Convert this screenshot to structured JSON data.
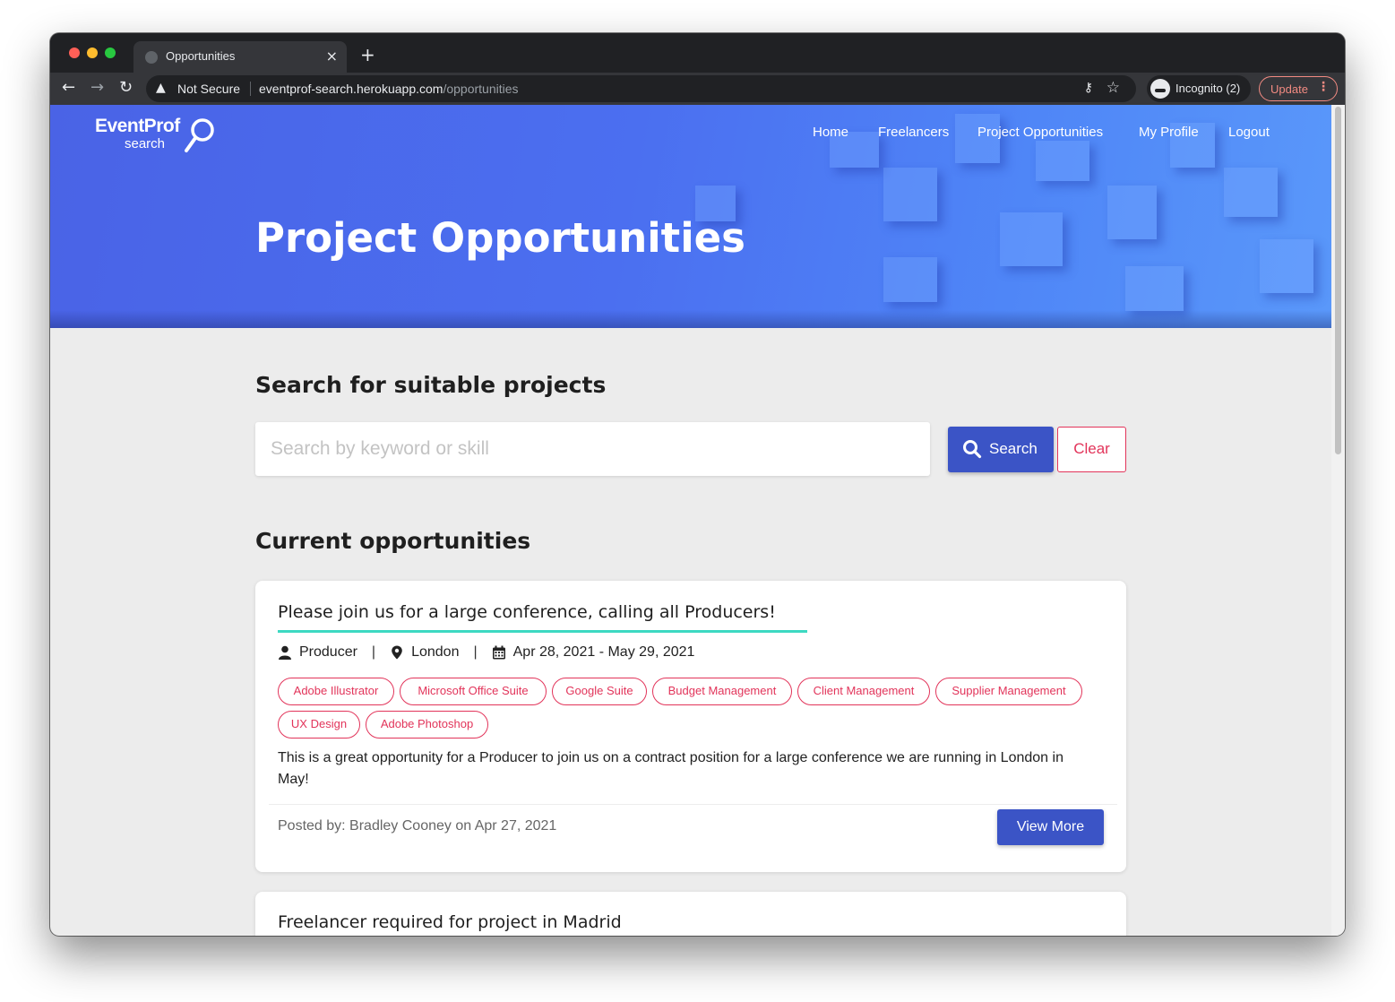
{
  "browser": {
    "tab_title": "Opportunities",
    "tab_close": "×",
    "new_tab": "+",
    "not_secure": "Not Secure",
    "url_host": "eventprof-search.herokuapp.com",
    "url_path": "/opportunities",
    "incognito_label": "Incognito (2)",
    "update_label": "Update"
  },
  "brand": {
    "logo_word": "EventProf",
    "logo_sub": "search"
  },
  "nav": {
    "home": "Home",
    "freelancers": "Freelancers",
    "project_opportunities": "Project Opportunities",
    "my_profile": "My Profile",
    "logout": "Logout"
  },
  "hero": {
    "title": "Project Opportunities"
  },
  "search": {
    "heading": "Search for suitable projects",
    "placeholder": "Search by keyword or skill",
    "value": "",
    "search_label": "Search",
    "clear_label": "Clear"
  },
  "opportunities": {
    "heading": "Current opportunities",
    "items": [
      {
        "title": "Please join us for a large conference, calling all Producers!",
        "role": "Producer",
        "location": "London",
        "dates": "Apr 28, 2021 - May 29, 2021",
        "skills": [
          "Adobe Illustrator",
          "Microsoft Office Suite",
          "Google Suite",
          "Budget Management",
          "Client Management",
          "Supplier Management",
          "UX Design",
          "Adobe Photoshop"
        ],
        "description": "This is a great opportunity for a Producer to join us on a contract position for a large conference we are running in London in May!",
        "posted": "Posted by: Bradley Cooney on Apr 27, 2021",
        "view_more": "View More"
      },
      {
        "title": "Freelancer required for project in Madrid"
      }
    ]
  },
  "colors": {
    "primary": "#3b54c6",
    "accent": "#e2345a",
    "underline": "#3dd9c2",
    "hero_start": "#4a63e6",
    "hero_end": "#5a98fa"
  }
}
